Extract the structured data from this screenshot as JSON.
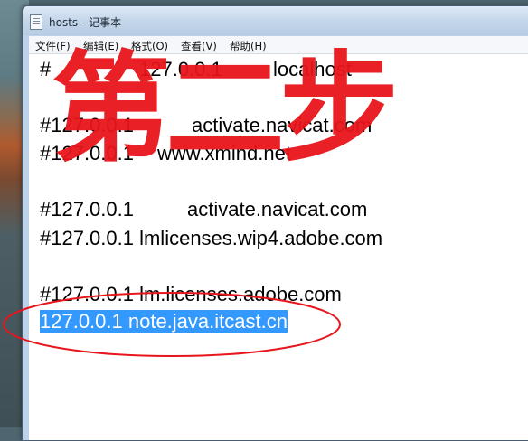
{
  "window": {
    "title": "hosts - 记事本"
  },
  "menu": {
    "items": [
      "文件(F)",
      "编辑(E)",
      "格式(O)",
      "查看(V)",
      "帮助(H)"
    ]
  },
  "editor": {
    "lines": [
      "#\t\t127.0.0.1\tlocalhost",
      "",
      "#127.0.0.1\tactivate.navicat.com",
      "#127.0.0.1\twww.xmind.net",
      "",
      "#127.0.0.1\tactivate.navicat.com",
      "#127.0.0.1 lmlicenses.wip4.adobe.com",
      "",
      "#127.0.0.1 lm.licenses.adobe.com",
      "127.0.0.1 note.java.itcast.cn"
    ],
    "selected_line_index": 9
  },
  "annotation": {
    "overlay_text": "第二步",
    "highlight_color": "#e8161c"
  }
}
